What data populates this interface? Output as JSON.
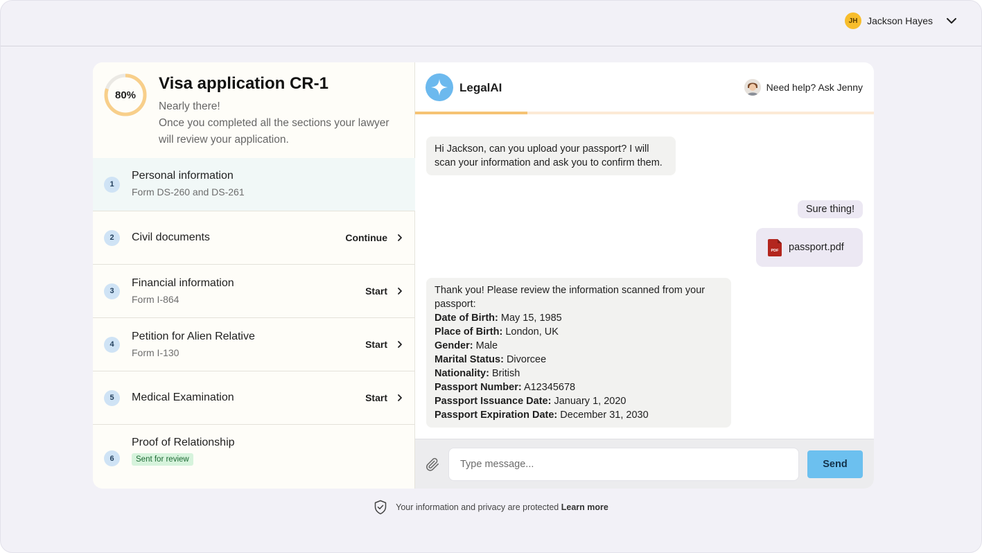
{
  "user": {
    "initials": "JH",
    "name": "Jackson Hayes"
  },
  "application": {
    "progress_label": "80%",
    "progress_fraction": 0.8,
    "title": "Visa application CR-1",
    "subtitle": "Nearly there!",
    "description": "Once you completed all the sections your lawyer will review your application."
  },
  "steps": [
    {
      "number": "1",
      "title": "Personal information",
      "subtitle": "Form DS-260 and DS-261"
    },
    {
      "number": "2",
      "title": "Civil documents",
      "action": "Continue"
    },
    {
      "number": "3",
      "title": "Financial information",
      "subtitle": "Form I-864",
      "action": "Start"
    },
    {
      "number": "4",
      "title": "Petition for Alien Relative",
      "subtitle": "Form I-130",
      "action": "Start"
    },
    {
      "number": "5",
      "title": "Medical Examination",
      "action": "Start"
    },
    {
      "number": "6",
      "title": "Proof of Relationship",
      "badge": "Sent for review"
    }
  ],
  "chat": {
    "brand": "LegalAI",
    "help_text": "Need help? Ask Jenny",
    "progress_fraction": 0.245,
    "messages": {
      "bot_1": "Hi Jackson, can you upload your passport? I will scan your information and ask you to confirm them.",
      "user_1": "Sure thing!",
      "file_name": "passport.pdf",
      "file_icon_label": "PDF",
      "bot_2_intro": "Thank you! Please review the information scanned from your passport:",
      "fields": [
        {
          "label": "Date of Birth:",
          "value": "May 15, 1985"
        },
        {
          "label": "Place of Birth:",
          "value": "London, UK"
        },
        {
          "label": "Gender:",
          "value": "Male"
        },
        {
          "label": "Marital Status:",
          "value": "Divorcee"
        },
        {
          "label": "Nationality:",
          "value": "British"
        },
        {
          "label": "Passport Number:",
          "value": "A12345678"
        },
        {
          "label": "Passport Issuance Date:",
          "value": "January 1, 2020"
        },
        {
          "label": "Passport Expiration Date:",
          "value": "December 31, 2030"
        }
      ]
    },
    "composer": {
      "placeholder": "Type message...",
      "send_label": "Send"
    }
  },
  "footer": {
    "text": "Your information and privacy are protected",
    "link": "Learn more"
  },
  "colors": {
    "accent_orange": "#f6c374",
    "accent_blue": "#6cb9ee",
    "badge_green": "#d6f3dc"
  }
}
